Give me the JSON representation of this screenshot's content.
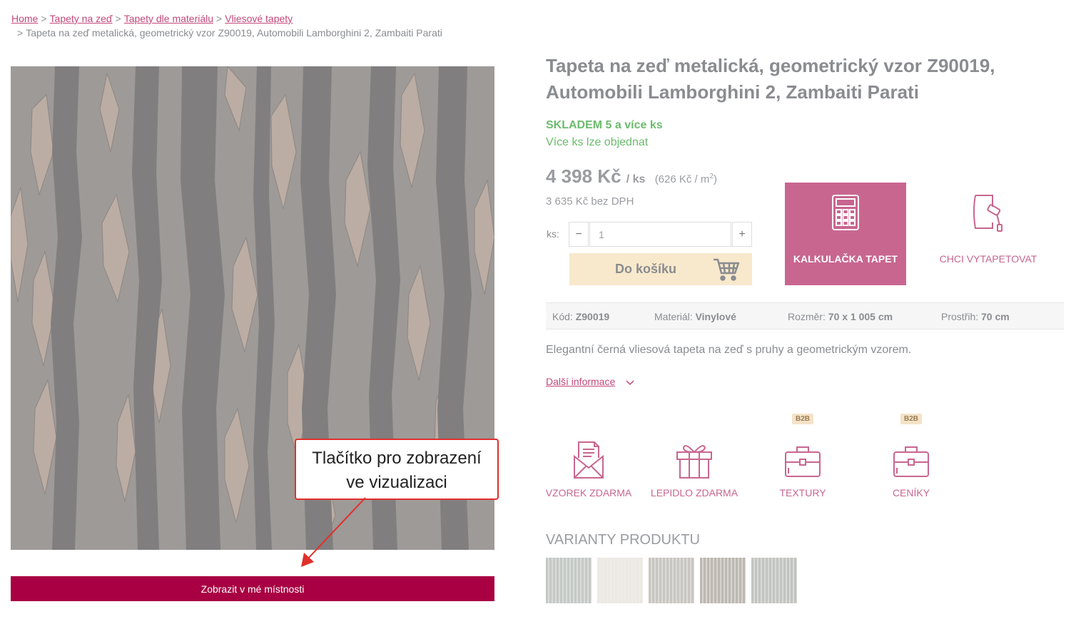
{
  "breadcrumb": {
    "items": [
      "Home",
      "Tapety na zeď",
      "Tapety dle materiálu",
      "Vliesové tapety"
    ],
    "current": "Tapeta na zeď metalická, geometrický vzor Z90019, Automobili Lamborghini 2, Zambaiti Parati",
    "separator": ">"
  },
  "product": {
    "title_line1": "Tapeta na zeď metalická, geometrický vzor Z90019,",
    "title_line2": "Automobili Lamborghini 2, Zambaiti Parati",
    "stock": "SKLADEM 5 a více ks",
    "stock_note": "Více ks lze objednat",
    "price": "4 398 Kč",
    "price_unit": "/ ks",
    "price_per_m2": "(626 Kč / m",
    "price_per_m2_sup": "2",
    "price_per_m2_close": ")",
    "price_ex_vat": "3 635 Kč bez DPH"
  },
  "quantity": {
    "label": "ks:",
    "minus": "−",
    "plus": "+",
    "value": "1"
  },
  "buttons": {
    "cart": "Do košíku",
    "calculator": "KALKULAČKA TAPET",
    "wallpapering": "CHCI VYTAPETOVAT",
    "view_room": "Zobrazit v mé místnosti"
  },
  "specs": [
    {
      "label": "Kód:",
      "value": "Z90019"
    },
    {
      "label": "Materiál:",
      "value": "Vinylové"
    },
    {
      "label": "Rozměr:",
      "value": "70 x 1 005 cm"
    },
    {
      "label": "Prostřih:",
      "value": "70 cm"
    }
  ],
  "description": "Elegantní černá vliesová tapeta na zeď s pruhy a geometrickým vzorem.",
  "more_info": "Další informace",
  "benefits": [
    {
      "label": "VZOREK ZDARMA",
      "icon": "envelope-icon",
      "badge": ""
    },
    {
      "label": "LEPIDLO ZDARMA",
      "icon": "gift-icon",
      "badge": ""
    },
    {
      "label": "TEXTURY",
      "icon": "briefcase-icon",
      "badge": "B2B"
    },
    {
      "label": "CENÍKY",
      "icon": "briefcase-icon",
      "badge": "B2B"
    }
  ],
  "variants": {
    "title": "VARIANTY PRODUKTU",
    "swatch_colors": [
      "#c5c9c6",
      "#ece9e2",
      "#c9c6c1",
      "#bdb8b1",
      "#c2c4c0"
    ]
  },
  "annotation": {
    "line1": "Tlačítko pro zobrazení",
    "line2": "ve vizualizaci"
  },
  "colors": {
    "accent": "#c86690",
    "link": "#c2487b",
    "stock_green": "#6cbb6d",
    "view_button": "#a80042",
    "cart_bg": "#f8e9cc",
    "callout_border": "#e0302c"
  }
}
